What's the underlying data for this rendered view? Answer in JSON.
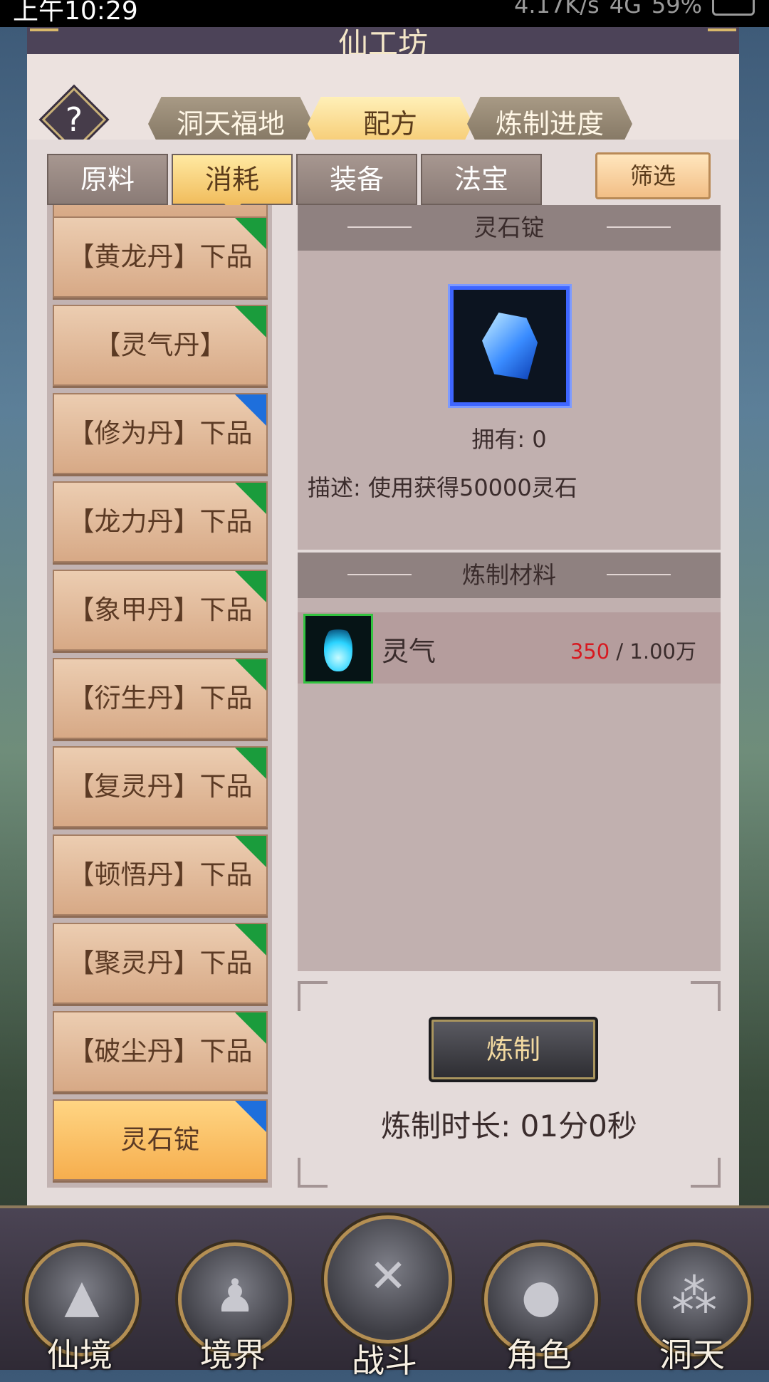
{
  "status_bar": {
    "time": "上午10:29",
    "network": "4.17K/s",
    "signal": "4G",
    "battery": "59%"
  },
  "window": {
    "title": "仙工坊"
  },
  "top_tabs": [
    {
      "label": "洞天福地",
      "active": false
    },
    {
      "label": "配方",
      "active": true
    },
    {
      "label": "炼制进度",
      "active": false
    }
  ],
  "help": {
    "label": "?"
  },
  "sub_tabs": [
    {
      "label": "原料",
      "active": false
    },
    {
      "label": "消耗",
      "active": true
    },
    {
      "label": "装备",
      "active": false
    },
    {
      "label": "法宝",
      "active": false
    }
  ],
  "filter": {
    "label": "筛选"
  },
  "recipes": [
    {
      "label": "【黄龙丹】下品",
      "badge": "green"
    },
    {
      "label": "【灵气丹】",
      "badge": "green"
    },
    {
      "label": "【修为丹】下品",
      "badge": "blue"
    },
    {
      "label": "【龙力丹】下品",
      "badge": "green"
    },
    {
      "label": "【象甲丹】下品",
      "badge": "green"
    },
    {
      "label": "【衍生丹】下品",
      "badge": "green"
    },
    {
      "label": "【复灵丹】下品",
      "badge": "green"
    },
    {
      "label": "【顿悟丹】下品",
      "badge": "green"
    },
    {
      "label": "【聚灵丹】下品",
      "badge": "green"
    },
    {
      "label": "【破尘丹】下品",
      "badge": "green"
    },
    {
      "label": "灵石锭",
      "badge": "blue",
      "selected": true
    }
  ],
  "detail": {
    "name": "灵石锭",
    "icon": "spirit-stone-icon",
    "owned": "拥有: 0",
    "description": "描述: 使用获得50000灵石",
    "materials_title": "炼制材料",
    "materials": [
      {
        "name": "灵气",
        "icon": "spirit-qi-flame-icon",
        "have": "350",
        "need": " / 1.00万"
      }
    ],
    "craft_button": "炼制",
    "craft_time": "炼制时长: 01分0秒"
  },
  "bottom_nav": [
    {
      "label": "仙境",
      "icon": "mountain-icon"
    },
    {
      "label": "境界",
      "icon": "meditation-icon"
    },
    {
      "label": "战斗",
      "icon": "crossed-swords-icon"
    },
    {
      "label": "角色",
      "icon": "character-icon"
    },
    {
      "label": "洞天",
      "icon": "triple-orb-icon"
    }
  ],
  "colors": {
    "accent_gold": "#f5c66a",
    "badge_green": "#1a9c3c",
    "badge_blue": "#1e6fdc",
    "qty_red": "#d71920"
  }
}
